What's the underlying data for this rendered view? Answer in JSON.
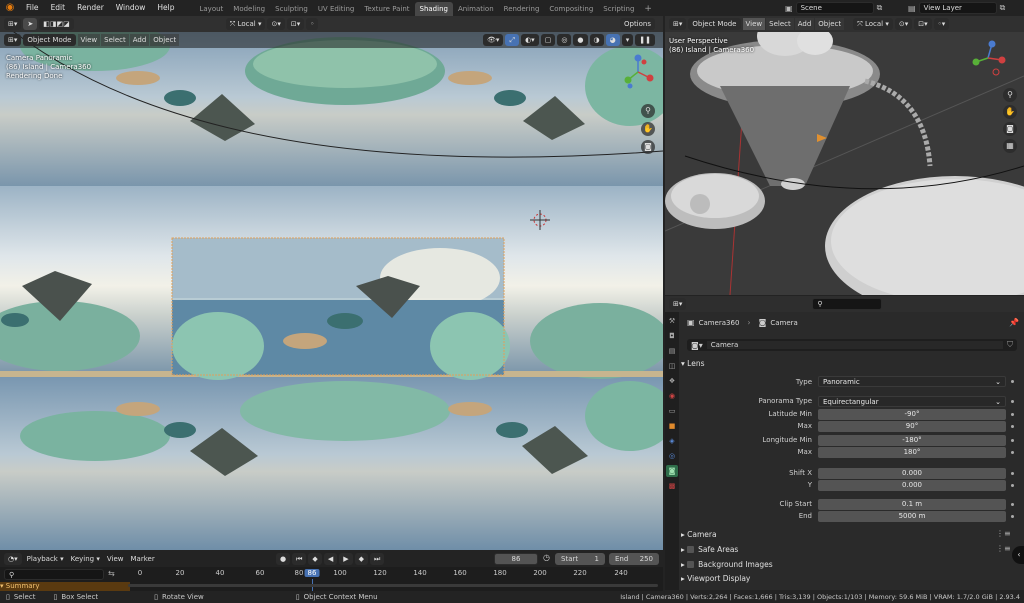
{
  "topbar": {
    "menus": [
      "File",
      "Edit",
      "Render",
      "Window",
      "Help"
    ],
    "workspaces": [
      "Layout",
      "Modeling",
      "Sculpting",
      "UV Editing",
      "Texture Paint",
      "Shading",
      "Animation",
      "Rendering",
      "Compositing",
      "Scripting"
    ],
    "active_workspace": "Shading",
    "scene": "Scene",
    "view_layer": "View Layer"
  },
  "left_toolbar": {
    "transform_orientation": "Local",
    "options": "Options"
  },
  "left_view": {
    "mode": "Object Mode",
    "menus": [
      "View",
      "Select",
      "Add",
      "Object"
    ],
    "overlay_line1": "Camera Panoramic",
    "overlay_line2": "(86) Island | Camera360",
    "overlay_line3": "Rendering Done"
  },
  "right_view": {
    "mode": "Object Mode",
    "menus": [
      "View",
      "Select",
      "Add",
      "Object"
    ],
    "orientation": "Local",
    "overlay_line1": "User Perspective",
    "overlay_line2": "(86) Island | Camera360"
  },
  "properties": {
    "object_name": "Camera360",
    "data_name": "Camera",
    "datablock": "Camera",
    "panel_lens": "Lens",
    "type_label": "Type",
    "type_value": "Panoramic",
    "panorama_type_label": "Panorama Type",
    "panorama_type_value": "Equirectangular",
    "lat_min_label": "Latitude Min",
    "lat_min_value": "-90°",
    "lat_max_label": "Max",
    "lat_max_value": "90°",
    "lon_min_label": "Longitude Min",
    "lon_min_value": "-180°",
    "lon_max_label": "Max",
    "lon_max_value": "180°",
    "shift_x_label": "Shift X",
    "shift_x_value": "0.000",
    "shift_y_label": "Y",
    "shift_y_value": "0.000",
    "clip_start_label": "Clip Start",
    "clip_start_value": "0.1 m",
    "clip_end_label": "End",
    "clip_end_value": "5000 m",
    "sub_panels": [
      "Camera",
      "Safe Areas",
      "Background Images",
      "Viewport Display"
    ]
  },
  "timeline": {
    "playback": "Playback",
    "keying": "Keying",
    "view": "View",
    "marker": "Marker",
    "current_frame": "86",
    "start_label": "Start",
    "start_value": "1",
    "end_label": "End",
    "end_value": "250",
    "ticks": [
      "0",
      "20",
      "40",
      "60",
      "80",
      "86",
      "100",
      "120",
      "140",
      "160",
      "180",
      "200",
      "220",
      "240"
    ],
    "summary": "Summary"
  },
  "statusbar": {
    "select": "Select",
    "box_select": "Box Select",
    "rotate_view": "Rotate View",
    "context_menu": "Object Context Menu",
    "stats": "Island | Camera360 | Verts:2,264 | Faces:1,666 | Tris:3,139 | Objects:1/103 | Memory: 59.6 MiB | VRAM: 1.7/2.0 GiB | 2.93.4"
  }
}
